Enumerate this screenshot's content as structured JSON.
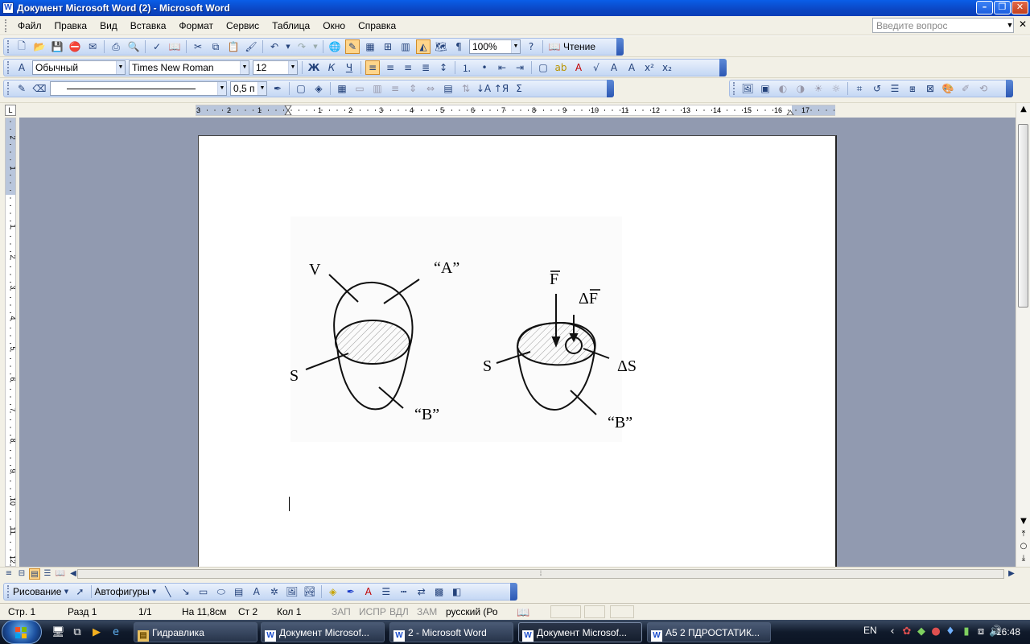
{
  "window": {
    "title": "Документ Microsoft Word (2) - Microsoft Word"
  },
  "menu": {
    "items": [
      "Файл",
      "Правка",
      "Вид",
      "Вставка",
      "Формат",
      "Сервис",
      "Таблица",
      "Окно",
      "Справка"
    ],
    "ask_placeholder": "Введите вопрос"
  },
  "toolbar_standard": {
    "zoom": "100%",
    "reading_label": "Чтение"
  },
  "toolbar_format": {
    "style": "Обычный",
    "font": "Times New Roman",
    "size": "12"
  },
  "toolbar_tables": {
    "line_weight": "0,5 п"
  },
  "ruler": {
    "h_left_labels": [
      "3",
      "2",
      "1"
    ],
    "h_labels": [
      "1",
      "2",
      "3",
      "4",
      "5",
      "6",
      "7",
      "8",
      "9",
      "10",
      "11",
      "12",
      "13",
      "14",
      "15",
      "16",
      "17"
    ],
    "v_labels": [
      "2",
      "1",
      "1",
      "1",
      "2",
      "3",
      "4",
      "5",
      "6",
      "7",
      "8",
      "9",
      "10",
      "11",
      "12"
    ]
  },
  "figure": {
    "left": {
      "v": "V",
      "a": "“A”",
      "s": "S",
      "b": "“B”"
    },
    "right": {
      "f": "F",
      "df": "ΔF",
      "s": "S",
      "ds": "ΔS",
      "b": "“B”"
    }
  },
  "drawing_toolbar": {
    "draw": "Рисование",
    "autoshapes": "Автофигуры"
  },
  "status": {
    "page": "Стр. 1",
    "section": "Разд 1",
    "pages": "1/1",
    "at": "На 11,8см",
    "line": "Ст 2",
    "col": "Кол 1",
    "rec": "ЗАП",
    "trk": "ИСПР",
    "ext": "ВДЛ",
    "ovr": "ЗАМ",
    "lang": "русский (Ро"
  },
  "taskbar": {
    "tasks": [
      "Гидравлика",
      "Документ Microsof...",
      "2 - Microsoft Word",
      "Документ Microsof...",
      "А5 2 ПДРОСТАТИК..."
    ],
    "lang": "EN",
    "time": "16:48"
  },
  "colors": {
    "titlebar": "#0b46c3",
    "workspace": "#919ab0",
    "toolbar": "#c4d7f4",
    "taskbar": "#101a2b"
  }
}
